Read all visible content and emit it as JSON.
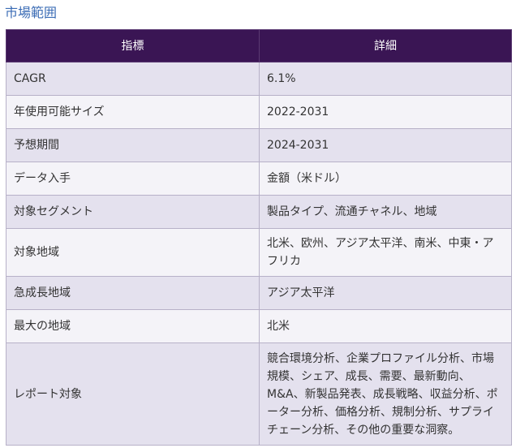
{
  "section_title": "市場範囲",
  "table": {
    "headers": [
      "指標",
      "詳細"
    ],
    "rows": [
      {
        "metric": "CAGR",
        "detail": "6.1%"
      },
      {
        "metric": "年使用可能サイズ",
        "detail": "2022-2031"
      },
      {
        "metric": "予想期間",
        "detail": "2024-2031"
      },
      {
        "metric": "データ入手",
        "detail": "金額（米ドル）"
      },
      {
        "metric": "対象セグメント",
        "detail": "製品タイプ、流通チャネル、地域"
      },
      {
        "metric": "対象地域",
        "detail": "北米、欧州、アジア太平洋、南米、中東・アフリカ"
      },
      {
        "metric": "急成長地域",
        "detail": "アジア太平洋"
      },
      {
        "metric": "最大の地域",
        "detail": "北米"
      },
      {
        "metric": "レポート対象",
        "detail": "競合環境分析、企業プロファイル分析、市場規模、シェア、成長、需要、最新動向、M&A、新製品発表、成長戦略、収益分析、ポーター分析、価格分析、規制分析、サプライチェーン分析、その他の重要な洞察。"
      }
    ]
  },
  "colors": {
    "header_bg": "#3a1554",
    "row_odd": "#e4e1ee",
    "row_even": "#f4f3f8",
    "title": "#3b6cb5"
  }
}
